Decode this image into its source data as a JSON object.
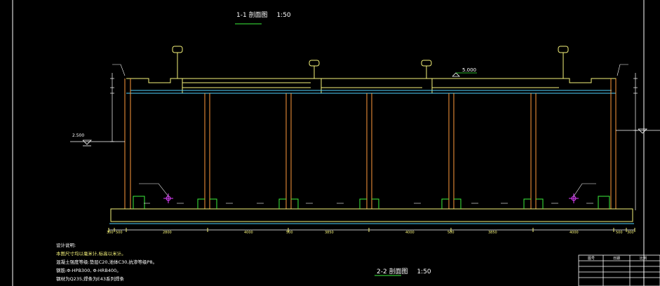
{
  "drawing": {
    "title_top": "1-1 剖面图",
    "scale_top": "1:50",
    "title_bottom": "2-2 剖面图",
    "scale_bottom": "1:50",
    "elev_top": "5.000",
    "elev_left": "2.500"
  },
  "notes": {
    "heading": "设计说明:",
    "lines": [
      "本图尺寸均以毫米计,标高以米计。",
      "混凝土强度等级:垫层C20,池体C30,抗渗等级P8。",
      "钢筋:Φ-HPB300, Φ-HRB400。",
      "钢材为Q235,焊条为E43系列焊条"
    ]
  },
  "dims": {
    "bottom": [
      "300",
      "500",
      "2800",
      "4000",
      "500",
      "3850",
      "4000",
      "500",
      "3850",
      "4000",
      "500",
      "300"
    ]
  },
  "title_block": {
    "headers": [
      "图号",
      "日期",
      "比例"
    ]
  },
  "colors": {
    "background": "#000000",
    "concrete": "#f5f27a",
    "columns": "#ff9a3c",
    "cyan": "#4fd3ff",
    "dims": "#f5f27a",
    "white": "#ffffff",
    "magenta": "#e040ff",
    "green": "#3cf03c"
  }
}
